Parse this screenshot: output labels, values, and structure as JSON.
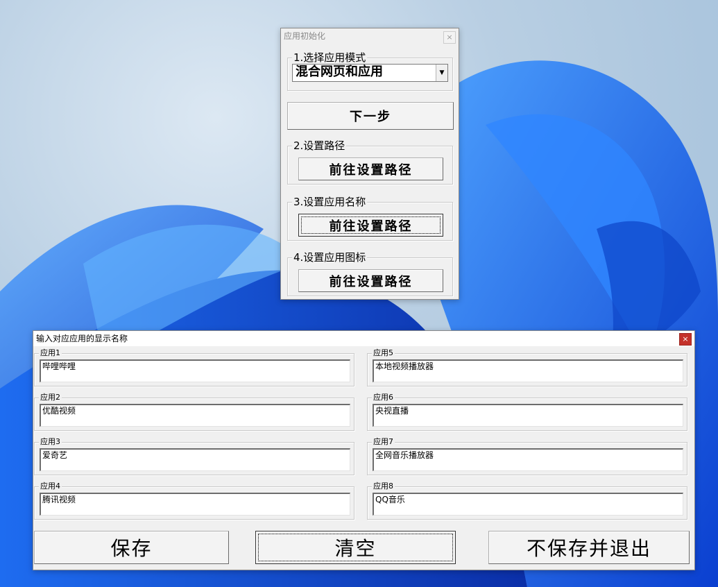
{
  "init_window": {
    "title": "应用初始化",
    "close_glyph": "×",
    "step1": {
      "legend": "1.选择应用模式",
      "combo_value": "混合网页和应用",
      "combo_arrow": "▼"
    },
    "next_button": "下一步",
    "step2": {
      "legend": "2.设置路径",
      "button": "前往设置路径"
    },
    "step3": {
      "legend": "3.设置应用名称",
      "button": "前往设置路径"
    },
    "step4": {
      "legend": "4.设置应用图标",
      "button": "前往设置路径"
    }
  },
  "name_window": {
    "title": "输入对应应用的显示名称",
    "close_glyph": "×",
    "apps": [
      {
        "label": "应用1",
        "value": "哔哩哔哩"
      },
      {
        "label": "应用2",
        "value": "优酷视频"
      },
      {
        "label": "应用3",
        "value": "爱奇艺"
      },
      {
        "label": "应用4",
        "value": "腾讯视频"
      },
      {
        "label": "应用5",
        "value": "本地视频播放器"
      },
      {
        "label": "应用6",
        "value": "央视直播"
      },
      {
        "label": "应用7",
        "value": "全网音乐播放器"
      },
      {
        "label": "应用8",
        "value": "QQ音乐"
      }
    ],
    "save_button": "保存",
    "clear_button": "清空",
    "exit_button": "不保存并退出"
  }
}
